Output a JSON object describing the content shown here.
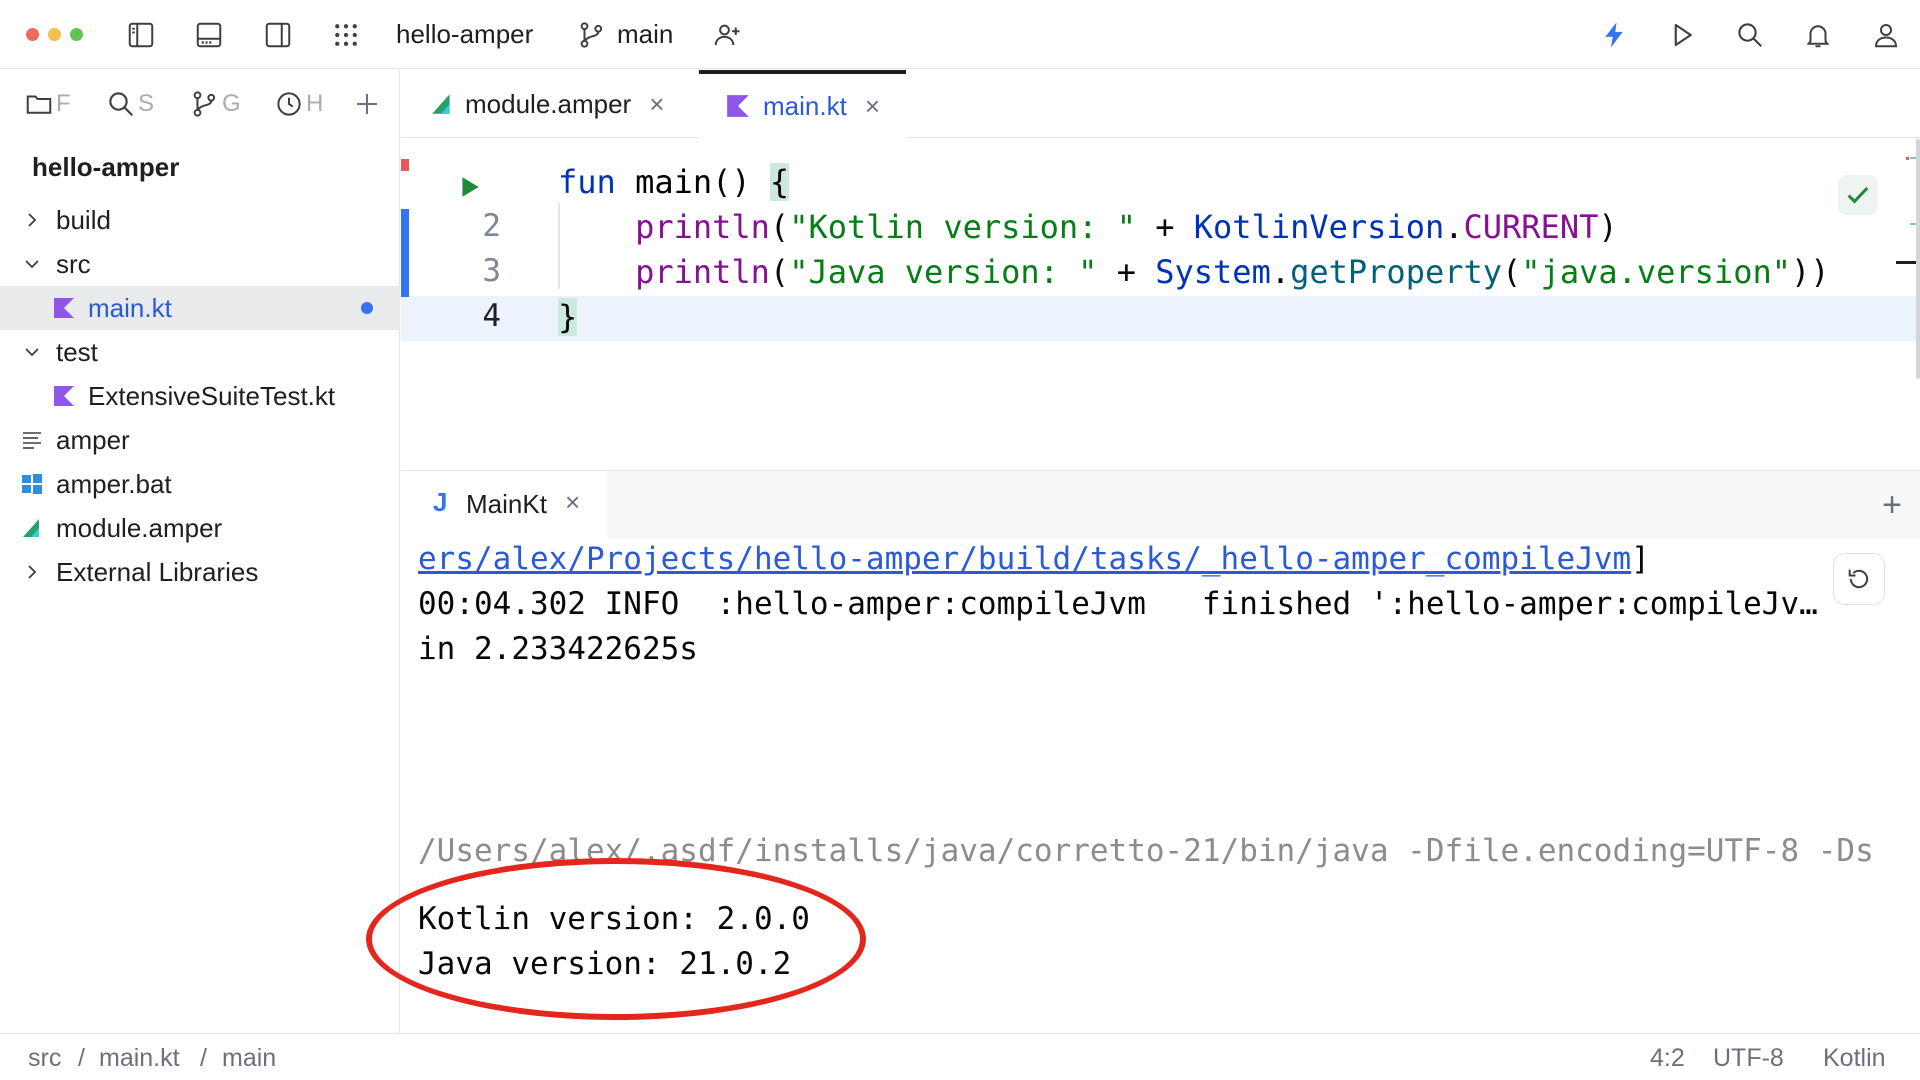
{
  "titlebar": {
    "project_name": "hello-amper",
    "branch": "main",
    "colors": {
      "close": "#ed6a5e",
      "minimize": "#f5bf4f",
      "maximize": "#61c554",
      "accent": "#3574f0"
    }
  },
  "toolstrip": {
    "tabs": [
      {
        "name": "project",
        "icon": "folder-icon",
        "label": "F"
      },
      {
        "name": "search",
        "icon": "search-icon",
        "label": "S"
      },
      {
        "name": "git",
        "icon": "git-branch-icon",
        "label": "G"
      },
      {
        "name": "history",
        "icon": "clock-icon",
        "label": "H"
      }
    ]
  },
  "project_tree": {
    "root": "hello-amper",
    "items": [
      {
        "label": "build",
        "expanded": false
      },
      {
        "label": "src",
        "expanded": true
      },
      {
        "label": "main.kt",
        "selected": true
      },
      {
        "label": "test",
        "expanded": true
      },
      {
        "label": "ExtensiveSuiteTest.kt"
      },
      {
        "label": "amper"
      },
      {
        "label": "amper.bat"
      },
      {
        "label": "module.amper"
      },
      {
        "label": "External Libraries",
        "expanded": false
      }
    ]
  },
  "editor_tabs": [
    {
      "label": "module.amper",
      "active": false
    },
    {
      "label": "main.kt",
      "active": true
    }
  ],
  "editor": {
    "line_numbers": [
      "2",
      "3",
      "4"
    ],
    "lines": {
      "l1": {
        "kw": "fun",
        "name": "main",
        "rest": "() ",
        "brace": "{"
      },
      "l2": {
        "indent": "    ",
        "call": "println",
        "p1": "(",
        "str": "\"Kotlin version: \"",
        "op": " + ",
        "cls": "KotlinVersion",
        "dot": ".",
        "const": "CURRENT",
        "p2": ")"
      },
      "l3": {
        "indent": "    ",
        "call": "println",
        "p1": "(",
        "str": "\"Java version: \"",
        "op": " + ",
        "cls": "System",
        "dot": ".",
        "method": "getProperty",
        "p2": "(",
        "str2": "\"java.version\"",
        "p3": "))"
      },
      "l4": {
        "brace": "}"
      }
    }
  },
  "run_panel": {
    "tab_label": "MainKt",
    "tab_icon_letter": "J",
    "console": {
      "link_line": "ers/alex/Projects/hello-amper/build/tasks/_hello-amper_compileJvm",
      "link_suffix": "]",
      "info_line": "00:04.302 INFO  :hello-amper:compileJvm   finished ':hello-amper:compileJv…",
      "info_line2": "in 2.233422625s",
      "command_line": "/Users/alex/.asdf/installs/java/corretto-21/bin/java -Dfile.encoding=UTF-8 -Ds",
      "output1": "Kotlin version: 2.0.0",
      "output2": "Java version: 21.0.2"
    }
  },
  "statusbar": {
    "breadcrumbs": [
      "src",
      "main.kt",
      "main"
    ],
    "separator": "/",
    "position": "4:2",
    "encoding": "UTF-8",
    "language": "Kotlin"
  }
}
